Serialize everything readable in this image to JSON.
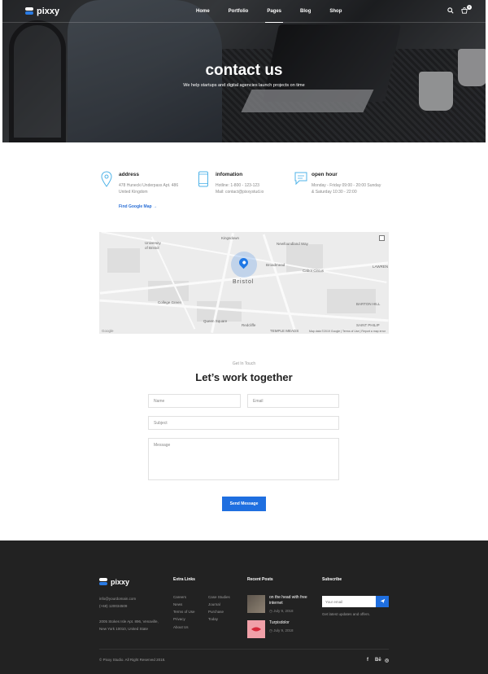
{
  "header": {
    "brand": "pixxy",
    "nav": [
      "Home",
      "Portfolio",
      "Pages",
      "Blog",
      "Shop"
    ],
    "active_nav": "Pages",
    "cart_count": "0",
    "icons": [
      "search-icon",
      "cart-icon"
    ]
  },
  "hero": {
    "title": "contact us",
    "subtitle": "We help startups and digital agencies launch projects on time"
  },
  "info": {
    "address": {
      "title": "address",
      "line1": "478 Hunecki Underpass Apt. 486",
      "line2": "United Kingdom",
      "icon": "location-pin-icon"
    },
    "information": {
      "title": "infomation",
      "line1": "Hotline: 1-800 - 123-123",
      "line2": "Mail: contact@pixxystud.io",
      "icon": "phone-icon"
    },
    "hours": {
      "title": "open hour",
      "line1": "Monday - Friday 09:00 - 20:00 Sunday",
      "line2": "& Saturday 10:30 - 22:00",
      "icon": "chat-bubble-icon"
    },
    "map_link": "Find Google Map →"
  },
  "map": {
    "city": "Bristol",
    "labels": {
      "university": "University",
      "of_bristol": "of Bristol",
      "lawrence": "LAWREN",
      "saint_philips": "SAINT PHILIP",
      "temple_meads": "TEMPLE MEADS",
      "broadmead": "Broadmead",
      "college_green": "College Green",
      "queen_square": "Queen Square",
      "cabot_circus": "Cabot Circus",
      "newfound": "Newfoundland Way",
      "barton": "BARTON HILL",
      "redcliffe": "Redcliffe",
      "kingsdown": "Kingsdown"
    },
    "credit": "Map data ©2019 Google | Terms of Use | Report a map error",
    "google": "Google"
  },
  "form": {
    "eyebrow": "Get In Touch",
    "title": "Let’s work together",
    "name_placeholder": "Name",
    "email_placeholder": "Email",
    "subject_placeholder": "Subject",
    "message_placeholder": "Message",
    "submit": "Send Message"
  },
  "footer": {
    "brand": "pixxy",
    "email": "info@yourdomain.com",
    "phone": "(+68) 120034509",
    "address1": "2005 Stokes Isle Apt. 896, Venaville,",
    "address2": "New York 10010, United State",
    "extra_links_title": "Extra Links",
    "links_col1": [
      "Careers",
      "News",
      "Terms of Use",
      "Privacy",
      "About Us"
    ],
    "links_col2": [
      "Case Studies",
      "Journal",
      "Purchase",
      "Today"
    ],
    "recent_posts_title": "Recent Posts",
    "posts": [
      {
        "title_line1": "on the head with free",
        "title_line2": "internet",
        "date": "July 9, 2018"
      },
      {
        "title_line1": "Turpisdolor",
        "title_line2": "",
        "date": "July 9, 2018"
      }
    ],
    "subscribe_title": "Subscribe",
    "subscribe_placeholder": "Your email",
    "subscribe_note": "Get latest updates and offers.",
    "copyright": "© Pixxy Studio. All Right Reserved 2018.",
    "social": [
      "f",
      "Bē",
      "◎"
    ],
    "social_icons": [
      "facebook-icon",
      "behance-icon",
      "dribbble-icon"
    ]
  },
  "colors": {
    "accent": "#1f6fe0",
    "footer_bg": "#222222",
    "post_thumb_2": "#f0a0a8"
  }
}
